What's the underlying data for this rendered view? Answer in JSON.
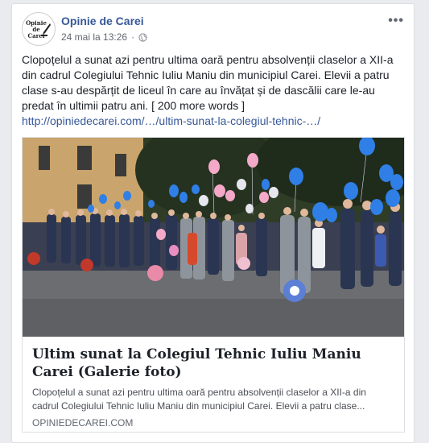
{
  "page": {
    "name": "Opinie de Carei",
    "logo_text": "Opinie de Carei",
    "timestamp": "24 mai la 13:26",
    "separator": "·",
    "audience_icon": "globe-icon",
    "more_label": "•••"
  },
  "post": {
    "text": "Clopoțelul a sunat azi pentru ultima oară pentru absolvenții claselor a XII-a din cadrul Colegiului Tehnic Iuliu Maniu din municipiul Carei. Elevii a patru clase s-au despărțit de liceul în care au învățat și de dascălii care le-au predat în ultimii patru ani. [ 200 more words ]",
    "link": "http://opiniedecarei.com/…/ultim-sunat-la-colegiul-tehnic-…/"
  },
  "attachment": {
    "title": "Ultim sunat la Colegiul Tehnic Iuliu Maniu Carei (Galerie foto)",
    "description": "Clopoțelul a sunat azi pentru ultima oară pentru absolvenții claselor a XII-a din cadrul Colegiului Tehnic Iuliu Maniu din municipiul Carei. Elevii a patru clase...",
    "domain": "OPINIEDECAREI.COM"
  },
  "colors": {
    "link": "#365899",
    "balloon_blue": "#2f7fe6",
    "balloon_pink": "#f4a9c8"
  }
}
